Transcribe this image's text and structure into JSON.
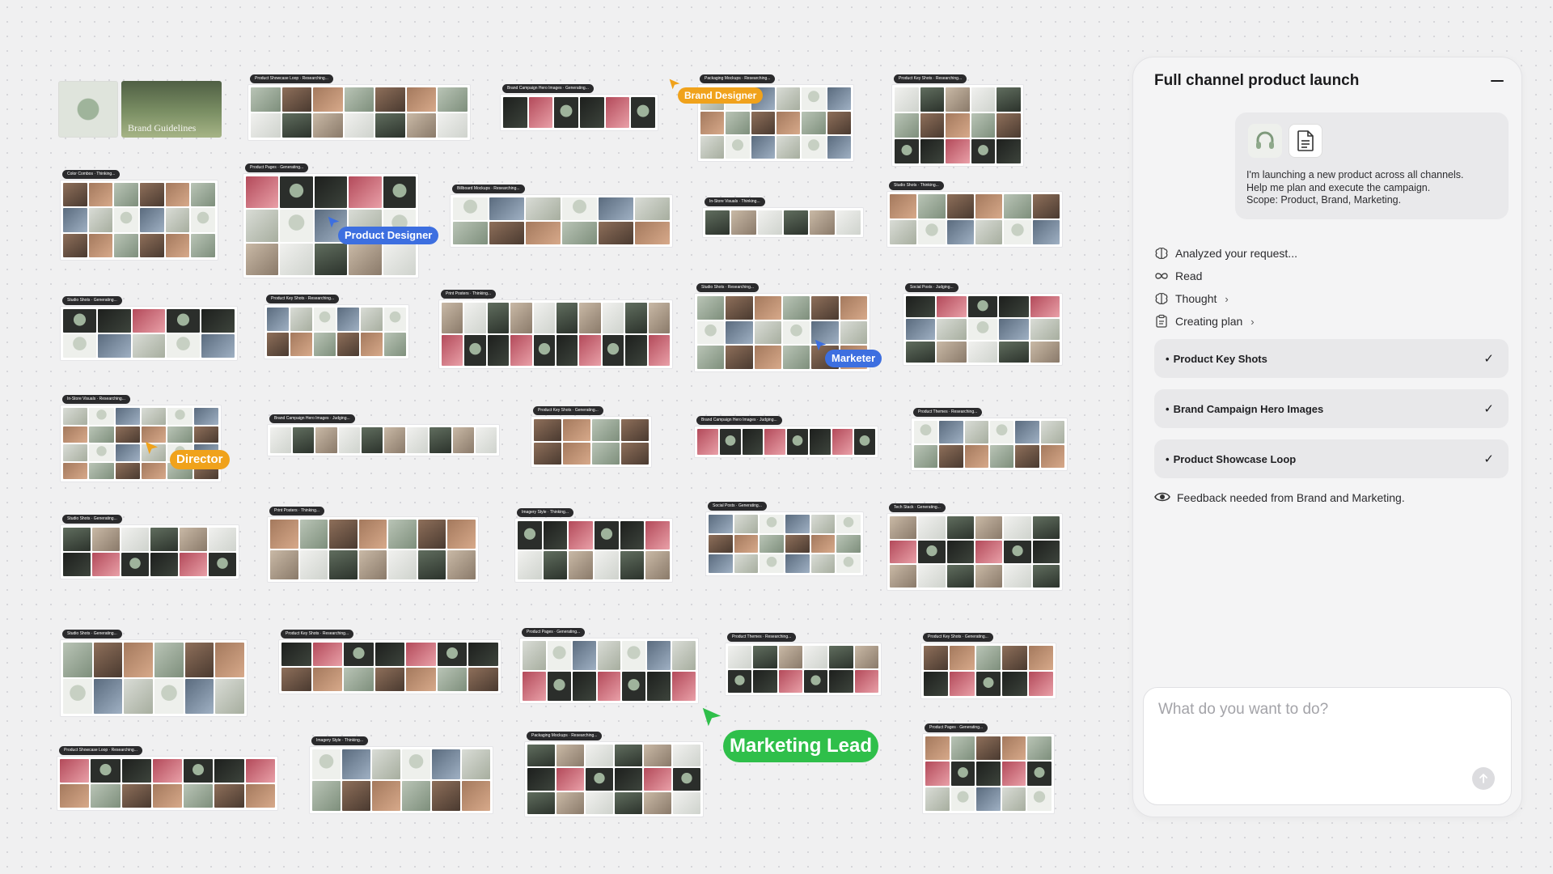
{
  "panel": {
    "title": "Full channel product launch",
    "attachments": [
      {
        "icon": "headphones-icon"
      },
      {
        "icon": "document-icon"
      }
    ],
    "request_lines": [
      "I'm launching a new product across all channels.",
      "Help me plan and execute the campaign.",
      "Scope: Product, Brand, Marketing."
    ],
    "steps": [
      {
        "icon": "brain-icon",
        "label": "Analyzed your request...",
        "chevron": ""
      },
      {
        "icon": "infinity-icon",
        "label": "Read",
        "chevron": ""
      },
      {
        "icon": "brain-icon",
        "label": "Thought",
        "chevron": "›"
      },
      {
        "icon": "clipboard-icon",
        "label": "Creating plan",
        "chevron": "›"
      }
    ],
    "plan_items": [
      {
        "label": "Product Key Shots",
        "check": "✓"
      },
      {
        "label": "Brand Campaign Hero Images",
        "check": "✓"
      },
      {
        "label": "Product Showcase Loop",
        "check": "✓"
      }
    ],
    "feedback": "Feedback needed from Brand and Marketing.",
    "composer_placeholder": "What do you want to do?"
  },
  "hero": {
    "brand_guidelines": "Brand Guidelines"
  },
  "cursors": [
    {
      "label": "Brand Designer",
      "color": "#f0a21b"
    },
    {
      "label": "Product Designer",
      "color": "#3d6fe0"
    },
    {
      "label": "Marketer",
      "color": "#3d6fe0"
    },
    {
      "label": "Director",
      "color": "#f0a21b"
    },
    {
      "label": "Marketing Lead",
      "color": "#2fbf4a"
    }
  ],
  "boards": [
    {
      "tag": "Product Showcase Loop · Researching..."
    },
    {
      "tag": "Brand Campaign Hero Images · Generating..."
    },
    {
      "tag": "Packaging Mockups · Researching..."
    },
    {
      "tag": "Product Key Shots · Researching..."
    },
    {
      "tag": "Color Combos · Thinking..."
    },
    {
      "tag": "Product Pages · Generating..."
    },
    {
      "tag": "Billboard Mockups · Researching..."
    },
    {
      "tag": "In-Store Visuals · Thinking..."
    },
    {
      "tag": "Studio Shots · Thinking..."
    },
    {
      "tag": "Studio Shots · Generating..."
    },
    {
      "tag": "Product Key Shots · Researching..."
    },
    {
      "tag": "Print Posters · Thinking..."
    },
    {
      "tag": "Studio Shots · Researching..."
    },
    {
      "tag": "Social Posts · Judging..."
    },
    {
      "tag": "In-Store Visuals · Researching..."
    },
    {
      "tag": "Brand Campaign Hero Images · Judging..."
    },
    {
      "tag": "Product Key Shots · Generating..."
    },
    {
      "tag": "Brand Campaign Hero Images · Judging..."
    },
    {
      "tag": "Product Themes · Researching..."
    },
    {
      "tag": "Studio Shots · Generating..."
    },
    {
      "tag": "Print Posters · Thinking..."
    },
    {
      "tag": "Imagery Style · Thinking..."
    },
    {
      "tag": "Social Posts · Generating..."
    },
    {
      "tag": "Tech Stack · Generating..."
    },
    {
      "tag": "Studio Shots · Generating..."
    },
    {
      "tag": "Product Key Shots · Researching..."
    },
    {
      "tag": "Product Pages · Generating..."
    },
    {
      "tag": "Product Themes · Researching..."
    },
    {
      "tag": "Product Key Shots · Generating..."
    },
    {
      "tag": "Product Showcase Loop · Researching..."
    },
    {
      "tag": "Imagery Style · Thinking..."
    },
    {
      "tag": "Packaging Mockups · Researching..."
    },
    {
      "tag": "Product Pages · Generating..."
    }
  ]
}
